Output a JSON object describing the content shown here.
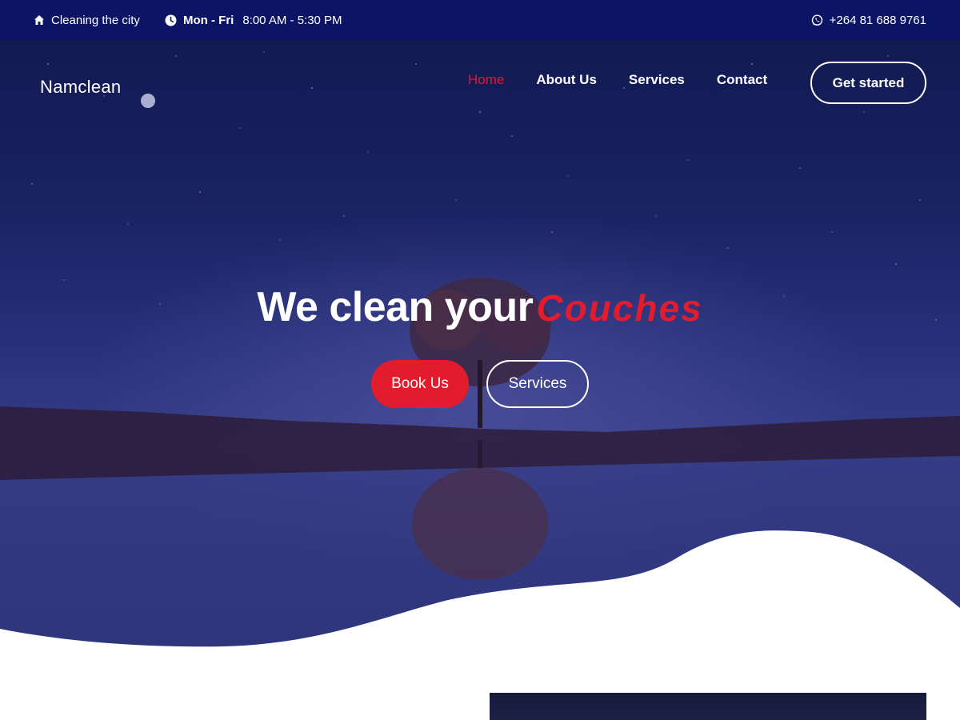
{
  "topbar": {
    "city_text": "Cleaning the city",
    "days_text": "Mon - Fri",
    "hours_text": "8:00 AM - 5:30 PM",
    "phone_text": "+264 81 688 9761",
    "icons": {
      "city": "home-icon",
      "hours": "clock-icon",
      "phone": "whatsapp-icon"
    }
  },
  "header": {
    "brand": "Namclean",
    "nav": [
      {
        "label": "Home",
        "active": true
      },
      {
        "label": "About Us",
        "active": false
      },
      {
        "label": "Services",
        "active": false
      },
      {
        "label": "Contact",
        "active": false
      }
    ],
    "cta_label": "Get started"
  },
  "hero": {
    "headline": "We clean your",
    "headline_accent": "Couches",
    "primary_button": "Book Us",
    "secondary_button": "Services"
  },
  "colors": {
    "topbar_bg": "#0c1466",
    "accent": "#e21b2d",
    "text_light": "#ffffff"
  }
}
